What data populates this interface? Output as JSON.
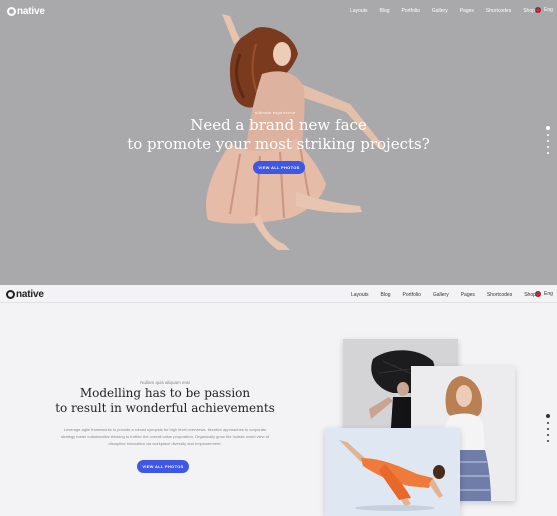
{
  "brand": {
    "name": "native"
  },
  "nav": {
    "items": [
      "Layouts",
      "Blog",
      "Portfolio",
      "Gallery",
      "Pages",
      "Shortcodes",
      "Shop"
    ],
    "language": "Eng"
  },
  "hero": {
    "subtitle": "ultimate experience",
    "title_line1": "Need a brand new face",
    "title_line2": "to promote your most striking projects?",
    "button_label": "VIEW ALL PHOTOS",
    "slides": 5,
    "active_slide": 1
  },
  "section": {
    "subtitle": "Nullam quis aliquam erat",
    "title_line1": "Modelling has to be passion",
    "title_line2": "to result in wonderful achievements",
    "body": "Leverage agile frameworks to provide a robust synopsis for high level overviews. Iterative approaches to corporate strategy foster collaborative thinking to further the overall value proposition. Organically grow the holistic world view of disruptive innovation via workplace diversity and empowerment.",
    "button_label": "VIEW ALL PHOTOS",
    "slides": 5,
    "active_slide": 1
  },
  "colors": {
    "accent": "#3e57e4",
    "hero_bg": "#a9a9ac",
    "section_bg": "#f3f3f5"
  }
}
